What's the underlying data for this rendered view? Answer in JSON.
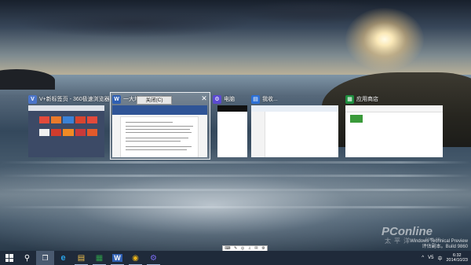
{
  "task_view": {
    "windows": [
      {
        "title": "V+新标签页 - 360极速浏览器",
        "icon": "browser-icon",
        "icon_color": "#4a74c9",
        "glyph": "V"
      },
      {
        "title": "一大堆 关闭(C) 更新",
        "icon": "wps-writer-icon",
        "icon_color": "#2f5fb3",
        "glyph": "W",
        "active": true,
        "tooltip": "关闭(C)",
        "close_glyph": "✕"
      },
      {
        "title": "电脑",
        "icon": "settings-icon",
        "icon_color": "#5b4ad1",
        "glyph": "⚙"
      },
      {
        "title": "我收...",
        "icon": "file-explorer-icon",
        "icon_color": "#2b6fd6",
        "glyph": "▤"
      },
      {
        "title": "应用商店",
        "icon": "store-icon",
        "icon_color": "#1e8e3e",
        "glyph": "▦"
      }
    ]
  },
  "watermark": {
    "brand": "PConline",
    "sub": "太平洋",
    "url": ".com.cn"
  },
  "build_stamp": {
    "line1": "Windows Technical Preview",
    "line2": "评估副本。Build 9860"
  },
  "taskbar": {
    "items": [
      {
        "name": "start-button",
        "type": "start"
      },
      {
        "name": "search-button",
        "glyph": "⚲"
      },
      {
        "name": "task-view-button",
        "glyph": "❐"
      },
      {
        "name": "ie-button",
        "glyph": "e",
        "color": "#2aa3e8"
      },
      {
        "name": "file-explorer-button",
        "glyph": "▤",
        "color": "#f1c14e"
      },
      {
        "name": "store-button",
        "glyph": "▦",
        "color": "#2e9c4a"
      },
      {
        "name": "wps-writer-button",
        "glyph": "W",
        "color": "#2f5fb3"
      },
      {
        "name": "chrome-button",
        "glyph": "◉",
        "color": "#e8b31a"
      },
      {
        "name": "settings-button",
        "glyph": "⚙",
        "color": "#7b6cf0"
      }
    ],
    "tray": {
      "chevron": "^",
      "ime": "V5",
      "lang": "中",
      "time": "6:32",
      "date": "2014/10/23"
    }
  },
  "tray_strip": {
    "glyphs": [
      "⌨",
      "✎",
      "◎",
      "♫",
      "✉",
      "⚙"
    ]
  }
}
